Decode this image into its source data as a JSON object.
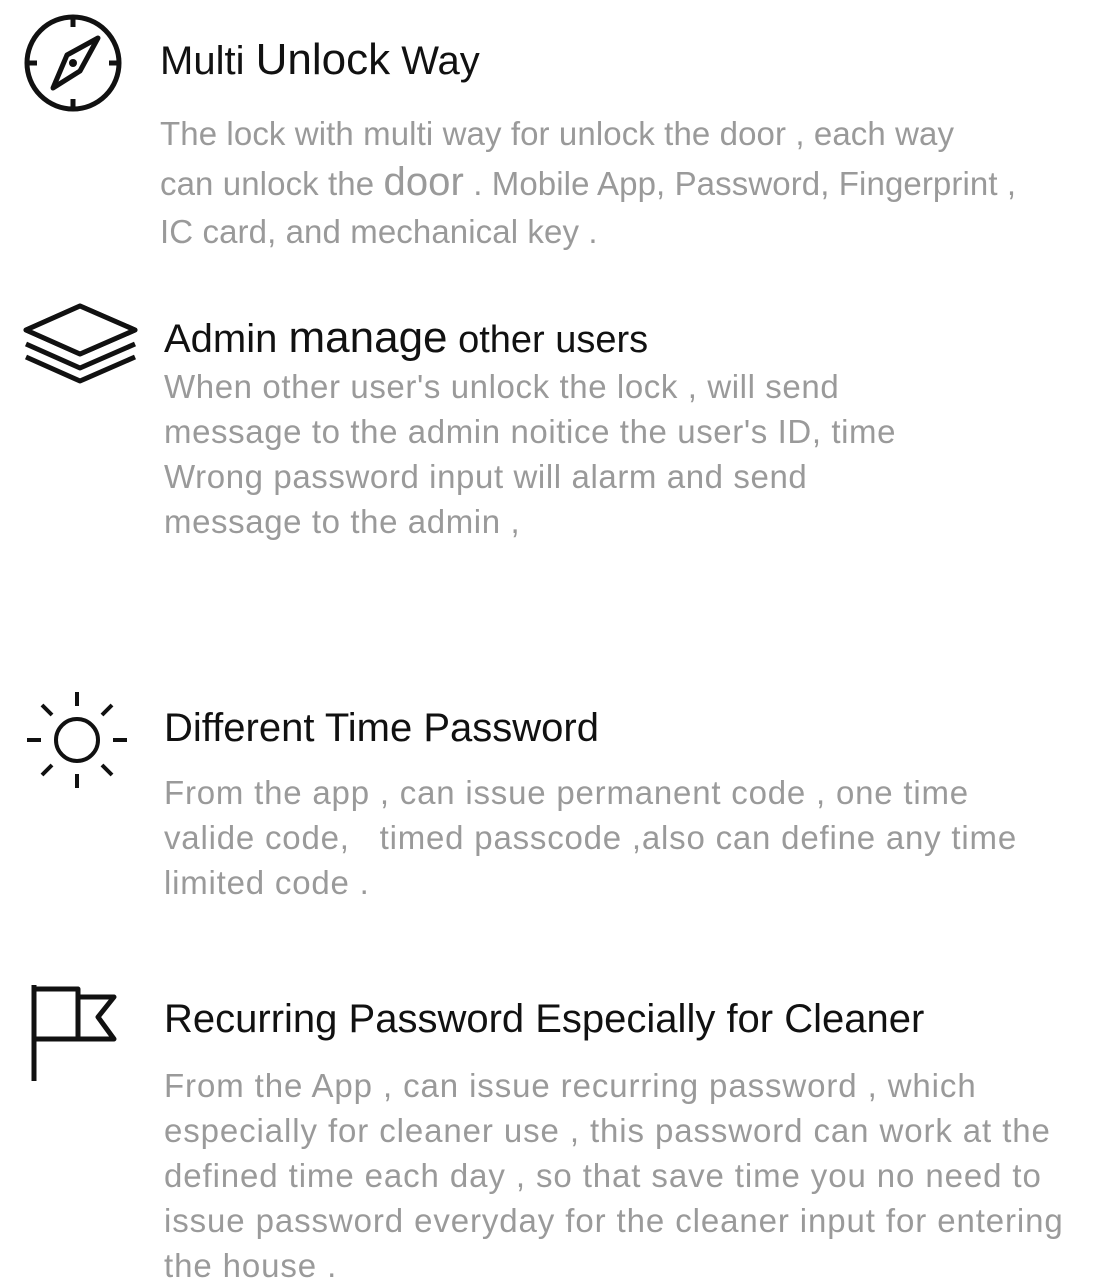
{
  "features": [
    {
      "icon": "compass-icon",
      "title_parts": [
        "Multi ",
        "Unlock",
        " Way"
      ],
      "description_lines": [
        "The lock with multi way for unlock the door , each way",
        [
          "can unlock the ",
          "door",
          " . Mobile App, Password, Fingerprint ,"
        ],
        "IC card, and mechanical key ."
      ]
    },
    {
      "icon": "layers-icon",
      "title_parts": [
        "Admin ",
        "manage",
        " other users"
      ],
      "description_lines": [
        "When other user's unlock the lock , will send",
        "message to the admin noitice the user's ID, time",
        "Wrong password input will alarm and send",
        "message to the admin ,"
      ]
    },
    {
      "icon": "sun-icon",
      "title": "Different Time Password",
      "description_lines": [
        "From the app , can issue permanent code , one time",
        "valide code,   timed passcode ,also can define any time",
        "limited code ."
      ]
    },
    {
      "icon": "flag-icon",
      "title": "Recurring Password Especially for Cleaner",
      "description_lines": [
        "From the App , can issue recurring password , which",
        "especially for cleaner use , this password can work at the",
        "defined time each day , so that save time you no need to",
        "issue password everyday for the cleaner input for entering",
        "the house ."
      ]
    }
  ]
}
